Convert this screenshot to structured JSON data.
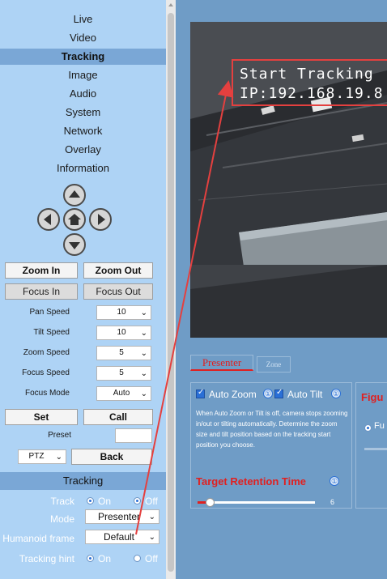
{
  "menu": [
    "Live",
    "Video",
    "Tracking",
    "Image",
    "Audio",
    "System",
    "Network",
    "Overlay",
    "Information"
  ],
  "active_menu": "Tracking",
  "ptz": {
    "zoom_in": "Zoom In",
    "zoom_out": "Zoom Out",
    "focus_in": "Focus In",
    "focus_out": "Focus Out",
    "pan_speed": {
      "label": "Pan Speed",
      "value": "10"
    },
    "tilt_speed": {
      "label": "Tilt Speed",
      "value": "10"
    },
    "zoom_speed": {
      "label": "Zoom Speed",
      "value": "5"
    },
    "focus_speed": {
      "label": "Focus Speed",
      "value": "5"
    },
    "focus_mode": {
      "label": "Focus Mode",
      "value": "Auto"
    },
    "set": "Set",
    "call": "Call",
    "preset_label": "Preset",
    "mode_select": "PTZ",
    "back": "Back"
  },
  "tracking": {
    "title": "Tracking",
    "track_label": "Track",
    "track_on": "On",
    "track_off": "Off",
    "mode_label": "Mode",
    "mode_value": "Presenter",
    "humanoid_label": "Humanoid frame",
    "humanoid_value": "Default",
    "hint_label": "Tracking hint",
    "hint_on": "On",
    "hint_off": "Off"
  },
  "video": {
    "osd_line1": "Start Tracking",
    "osd_line2": "IP:192.168.19.8"
  },
  "tabs": {
    "presenter": "Presenter",
    "zone": "Zone"
  },
  "panel": {
    "auto_zoom": "Auto Zoom",
    "auto_tilt": "Auto Tilt",
    "info_glyph": "①",
    "description": "When Auto Zoom or Tilt is off, camera stops zooming in/out or tilting automatically. Determine the zoom size and tilt position based on the tracking start position you choose.",
    "retention_title": "Target Retention Time",
    "retention_value": "6",
    "right_head": "Figu",
    "right_option": "Fu"
  },
  "colors": {
    "sidebar_bg": "#aed3f5",
    "active_menu_bg": "#7aa7d6",
    "main_bg": "#6f9cc6",
    "accent_red": "#e02020",
    "osd_box": "#e4403f"
  }
}
